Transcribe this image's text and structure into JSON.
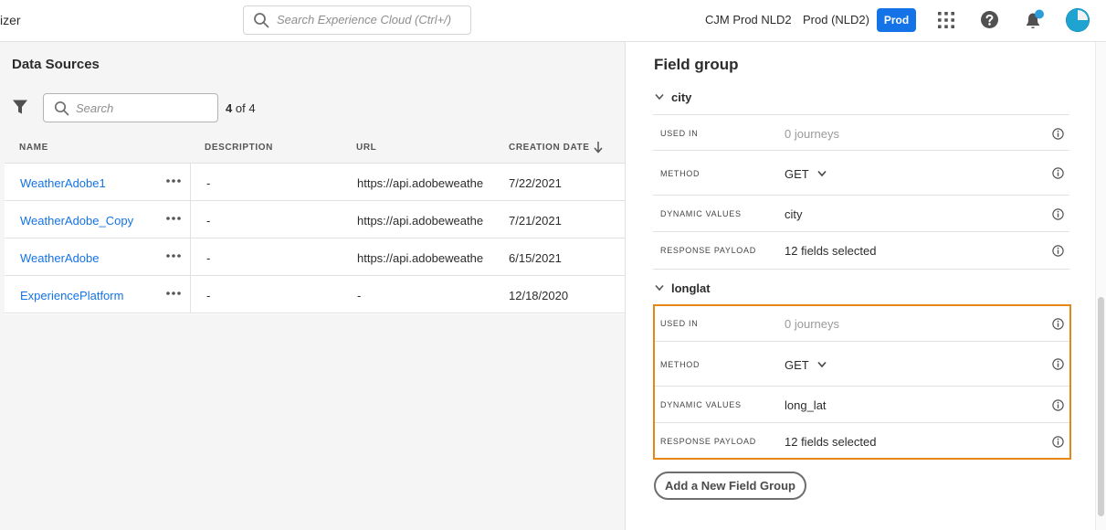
{
  "topbar": {
    "app_name": "izer",
    "search_placeholder": "Search Experience Cloud (Ctrl+/)",
    "org_name": "CJM Prod NLD2",
    "sandbox_name": "Prod (NLD2)",
    "env_badge": "Prod",
    "accent_color": "#1473e6",
    "icons": [
      "search-icon",
      "apps-grid-icon",
      "help-icon",
      "bell-icon",
      "avatar"
    ]
  },
  "data_sources": {
    "title": "Data Sources",
    "search_placeholder": "Search",
    "count_shown": "4",
    "count_total": "of 4",
    "columns": [
      "NAME",
      "DESCRIPTION",
      "URL",
      "CREATION DATE"
    ],
    "sort_column": "CREATION DATE",
    "sort_direction": "descending",
    "rows": [
      {
        "name": "WeatherAdobe1",
        "description": "-",
        "url": "https://api.adobeweathe",
        "date": "7/22/2021"
      },
      {
        "name": "WeatherAdobe_Copy",
        "description": "-",
        "url": "https://api.adobeweathe",
        "date": "7/21/2021"
      },
      {
        "name": "WeatherAdobe",
        "description": "-",
        "url": "https://api.adobeweathe",
        "date": "6/15/2021"
      },
      {
        "name": "ExperiencePlatform",
        "description": "-",
        "url": "-",
        "date": "12/18/2020"
      }
    ]
  },
  "field_group": {
    "title": "Field group",
    "groups": [
      {
        "name": "city",
        "used_in_label": "USED IN",
        "used_in_value": "0 journeys",
        "method_label": "METHOD",
        "method_value": "GET",
        "dynamic_label": "DYNAMIC VALUES",
        "dynamic_value": "city",
        "payload_label": "RESPONSE PAYLOAD",
        "payload_value": "12 fields selected"
      },
      {
        "name": "longlat",
        "used_in_label": "USED IN",
        "used_in_value": "0 journeys",
        "method_label": "METHOD",
        "method_value": "GET",
        "dynamic_label": "DYNAMIC VALUES",
        "dynamic_value": "long_lat",
        "payload_label": "RESPONSE PAYLOAD",
        "payload_value": "12 fields selected"
      }
    ],
    "highlight_color": "#e68619",
    "add_button_label": "Add a New Field Group"
  }
}
